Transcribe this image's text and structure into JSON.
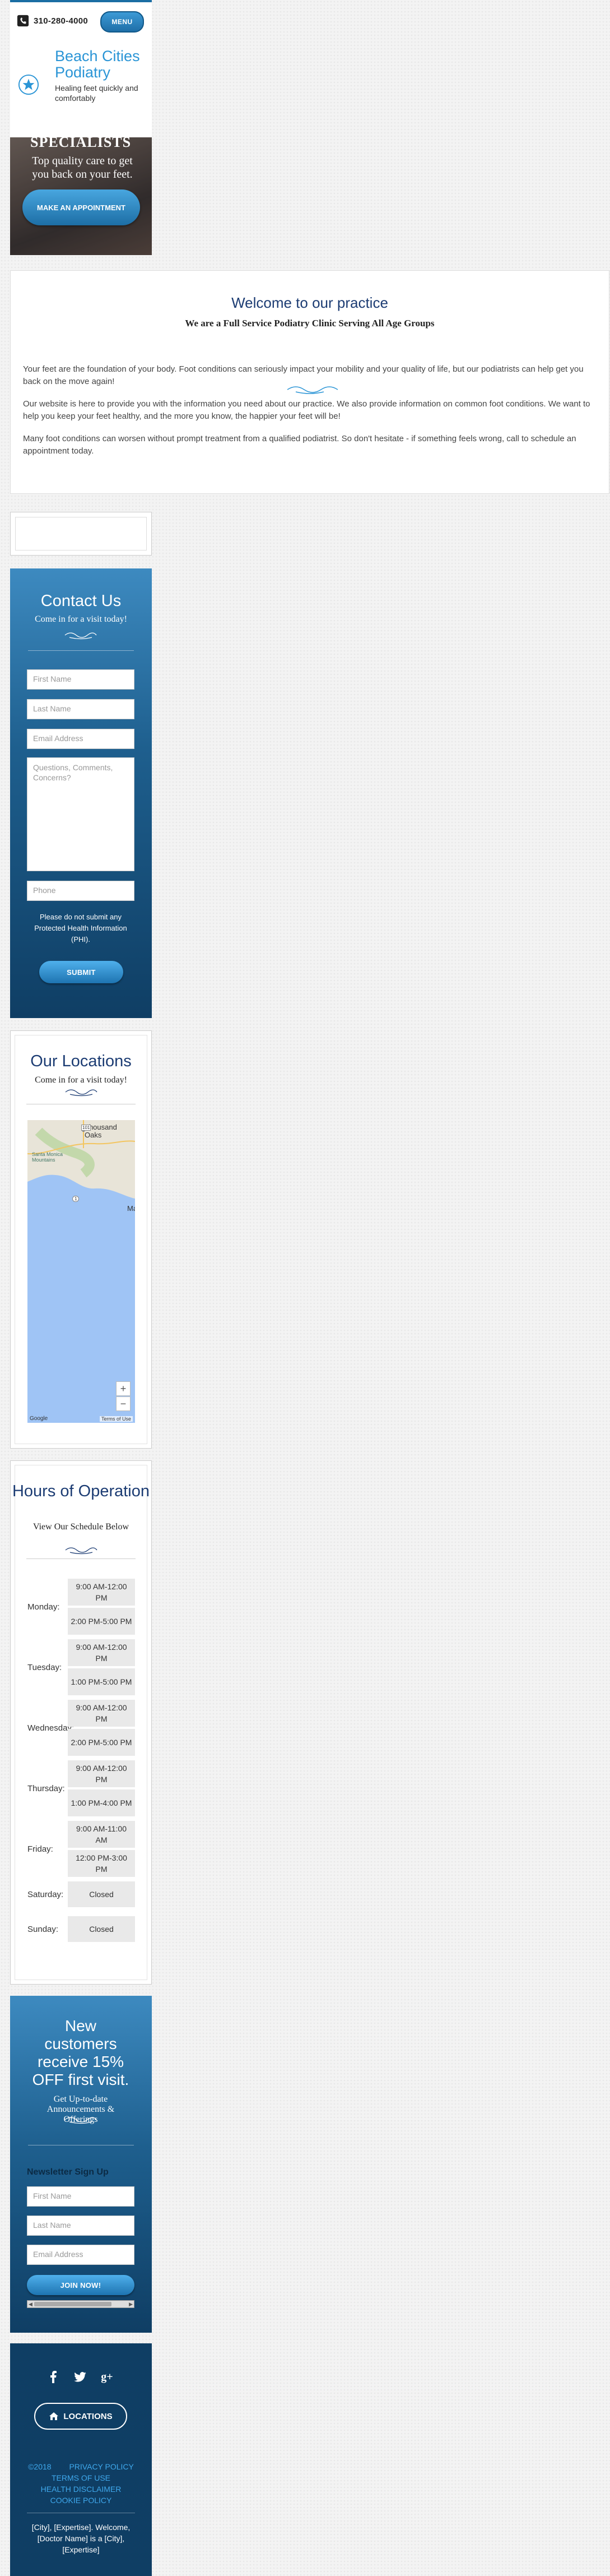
{
  "header": {
    "phone": "310-280-4000",
    "menu_label": "MENU",
    "brand_name": "Beach Cities Podiatry",
    "tagline": "Healing feet quickly and comfortably"
  },
  "banner": {
    "title": "SPECIALISTS",
    "subtitle": "Top quality care to get you back on your feet.",
    "button": "MAKE AN APPOINTMENT"
  },
  "welcome": {
    "title": "Welcome to our practice",
    "subtitle": "We are a Full Service Podiatry Clinic Serving All Age Groups",
    "paragraphs": [
      "Your feet are the foundation of your body. Foot conditions can seriously impact your mobility and your quality of life, but our podiatrists can help get you back on the move again!",
      "Our website is here to provide you with the information you need about our practice. We also provide information on common foot conditions. We want to help you keep your feet healthy, and the more you know, the happier your feet will be!",
      "Many foot conditions can worsen without prompt treatment from a qualified podiatrist. So don't hesitate - if something feels wrong, call to schedule an appointment today."
    ]
  },
  "contact": {
    "title": "Contact Us",
    "subtitle": "Come in for a visit today!",
    "fields": {
      "first_name": "First Name",
      "last_name": "Last Name",
      "email": "Email Address",
      "comments": "Questions, Comments, Concerns?",
      "phone": "Phone"
    },
    "notice": "Please do not submit any Protected Health Information (PHI).",
    "submit": "SUBMIT"
  },
  "locations": {
    "title": "Our Locations",
    "subtitle": "Come in for a visit today!",
    "map_labels": {
      "city": "Thousand Oaks",
      "mountains": "Santa Monica Mountains",
      "road": "101",
      "highway": "1",
      "edge": "Ma"
    },
    "zoom_in": "+",
    "zoom_out": "−",
    "google": "Google",
    "terms": "Terms of Use"
  },
  "hours": {
    "title": "Hours of Operation",
    "subtitle": "View Our Schedule Below",
    "days": [
      {
        "day": "Monday:",
        "slots": [
          "9:00 AM-12:00 PM",
          "2:00 PM-5:00 PM"
        ]
      },
      {
        "day": "Tuesday:",
        "slots": [
          "9:00 AM-12:00 PM",
          "1:00 PM-5:00 PM"
        ]
      },
      {
        "day": "Wednesday:",
        "slots": [
          "9:00 AM-12:00 PM",
          "2:00 PM-5:00 PM"
        ]
      },
      {
        "day": "Thursday:",
        "slots": [
          "9:00 AM-12:00 PM",
          "1:00 PM-4:00 PM"
        ]
      },
      {
        "day": "Friday:",
        "slots": [
          "9:00 AM-11:00 AM",
          "12:00 PM-3:00 PM"
        ]
      },
      {
        "day": "Saturday:",
        "slots": [
          "Closed"
        ]
      },
      {
        "day": "Sunday:",
        "slots": [
          "Closed"
        ]
      }
    ]
  },
  "newsletter": {
    "headline": "New customers receive 15% OFF first visit.",
    "subtitle": "Get Up-to-date Announcements & Offerings",
    "label": "Newsletter Sign Up",
    "fields": {
      "first_name": "First Name",
      "last_name": "Last Name",
      "email": "Email Address"
    },
    "button": "JOIN NOW!"
  },
  "footer": {
    "social": [
      "facebook-icon",
      "twitter-icon",
      "google-plus-icon"
    ],
    "locations_button": "LOCATIONS",
    "copyright": "©2018",
    "links": [
      "PRIVACY POLICY",
      "TERMS OF USE",
      "HEALTH DISCLAIMER",
      "COOKIE POLICY"
    ],
    "seo_text": "[City], [Expertise]. Welcome, [Doctor Name] is a [City], [Expertise]"
  },
  "colors": {
    "brand_blue": "#2b95d6",
    "navy": "#1c3c73",
    "panel_dark": "#0f3e64"
  }
}
